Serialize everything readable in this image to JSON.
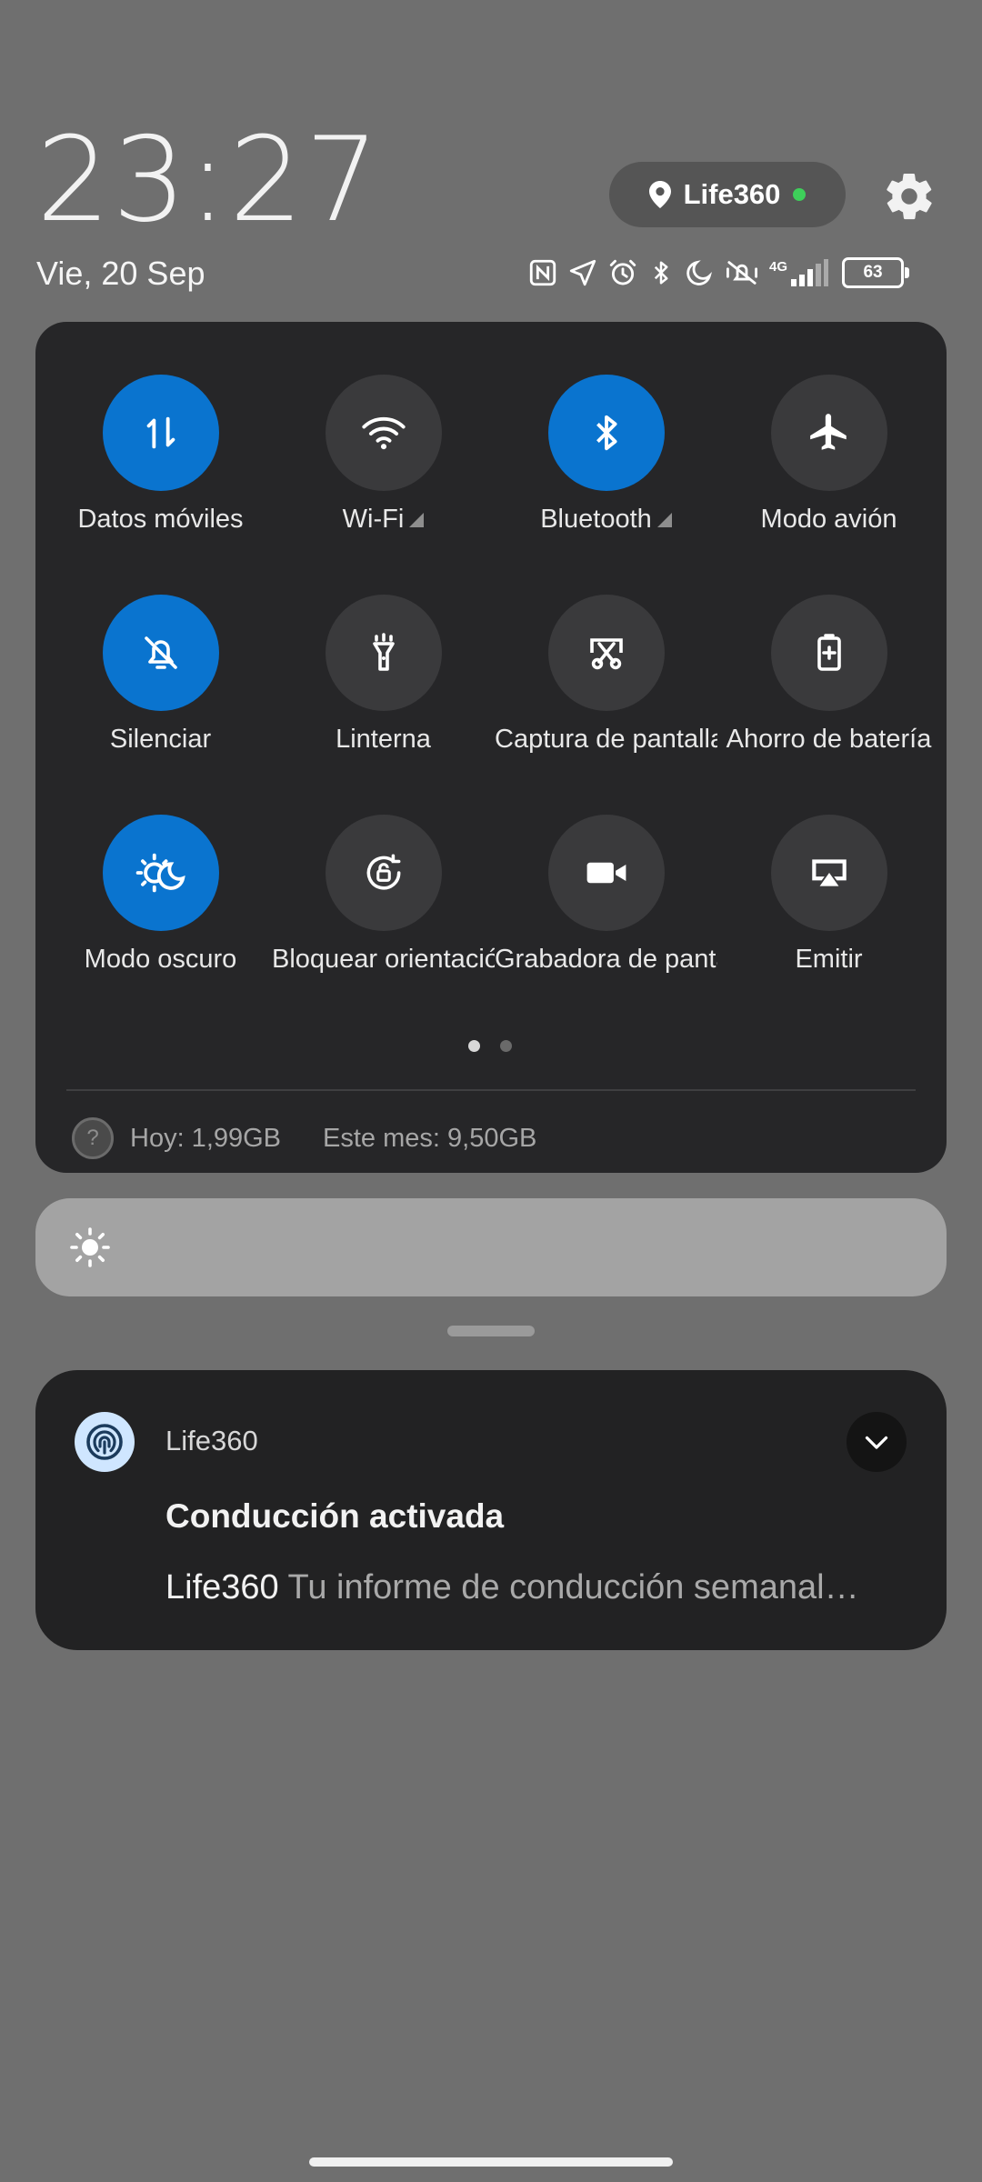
{
  "header": {
    "time": "23:27",
    "date": "Vie, 20 Sep",
    "location_chip": {
      "label": "Life360",
      "icon": "location-pin-icon",
      "status_color": "#3ecf5a"
    },
    "settings_icon": "gear-icon"
  },
  "status_bar": {
    "icons": [
      "nfc-icon",
      "location-arrow-icon",
      "alarm-icon",
      "bluetooth-icon",
      "moon-icon",
      "vibrate-off-icon",
      "signal-icon"
    ],
    "network": "4G",
    "battery": "63"
  },
  "quick_settings": {
    "tiles": [
      {
        "label": "Datos móviles",
        "icon": "mobile-data-icon",
        "active": true
      },
      {
        "label": "Wi-Fi",
        "icon": "wifi-icon",
        "active": false
      },
      {
        "label": "Bluetooth",
        "icon": "bluetooth-icon",
        "active": true
      },
      {
        "label": "Modo avión",
        "icon": "airplane-icon",
        "active": false
      },
      {
        "label": "Silenciar",
        "icon": "bell-off-icon",
        "active": true
      },
      {
        "label": "Linterna",
        "icon": "flashlight-icon",
        "active": false
      },
      {
        "label": "Captura de pantalla",
        "icon": "screenshot-icon",
        "active": false
      },
      {
        "label": "Ahorro de batería",
        "icon": "battery-saver-icon",
        "active": false
      },
      {
        "label": "Modo oscuro",
        "icon": "dark-mode-icon",
        "active": true
      },
      {
        "label": "Bloquear orientación",
        "icon": "rotation-lock-icon",
        "active": false
      },
      {
        "label": "Grabadora de pantalla",
        "icon": "video-camera-icon",
        "active": false
      },
      {
        "label": "Emitir",
        "icon": "cast-icon",
        "active": false
      }
    ],
    "page_dots": {
      "count": 2,
      "active": 0
    },
    "data_usage": {
      "today": "Hoy: 1,99GB",
      "month": "Este mes: 9,50GB"
    }
  },
  "brightness": {
    "icon": "sun-icon",
    "level": 0
  },
  "notification": {
    "app_name": "Life360",
    "title": "Conducción activada",
    "body_app": "Life360",
    "body_text": "Tu informe de conducción semanal…"
  },
  "colors": {
    "accent": "#0a74cf",
    "panel": "#262628",
    "background": "#6f6f6f"
  }
}
